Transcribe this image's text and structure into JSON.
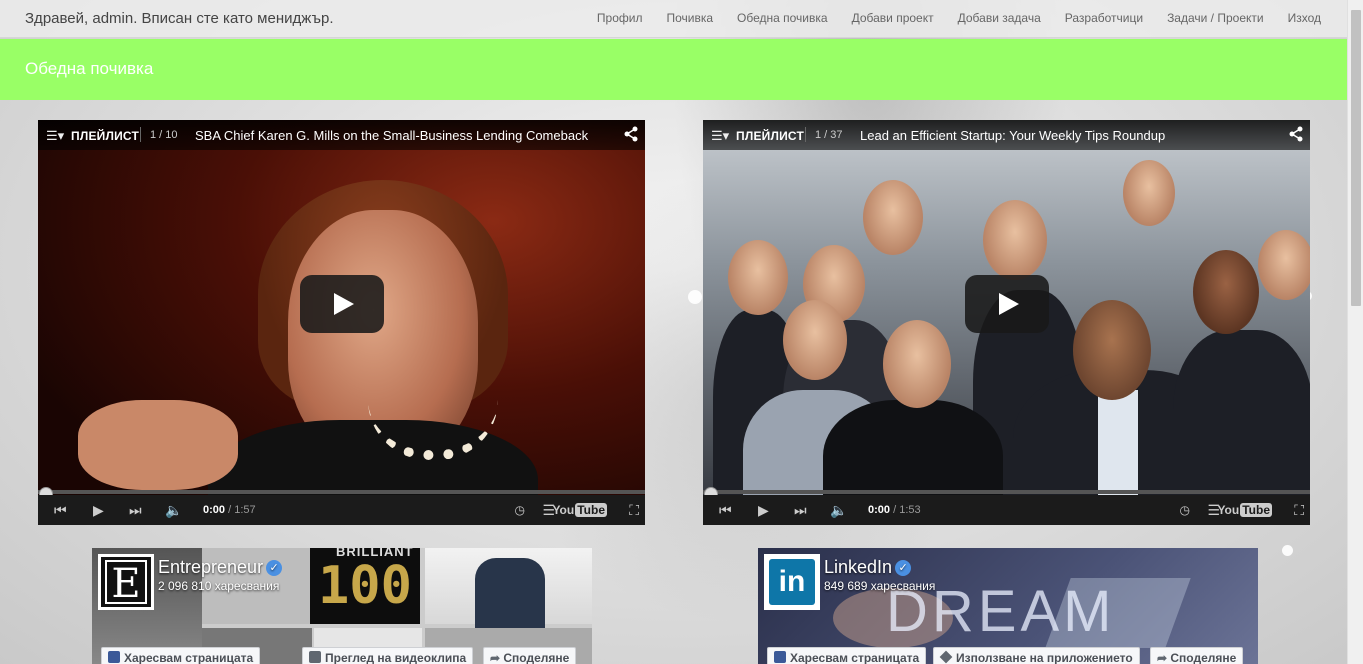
{
  "header": {
    "greeting": "Здравей, admin. Вписан сте като мениджър.",
    "nav": [
      "Профил",
      "Почивка",
      "Обедна почивка",
      "Добави проект",
      "Добави задача",
      "Разработчици",
      "Задачи / Проекти",
      "Изход"
    ]
  },
  "banner": {
    "title": "Обедна почивка"
  },
  "players": [
    {
      "playlist_label": "ПЛЕЙЛИСТ",
      "count": "1 / 10",
      "title": "SBA Chief Karen G. Mills on the Small-Business Lending Comeback",
      "time_current": "0:00",
      "time_total": "/ 1:57",
      "progress": 0
    },
    {
      "playlist_label": "ПЛЕЙЛИСТ",
      "count": "1 / 37",
      "title": "Lead an Efficient Startup: Your Weekly Tips Roundup",
      "time_current": "0:00",
      "time_total": "/ 1:53",
      "progress": 0
    }
  ],
  "player_logo": {
    "you": "You",
    "tube": "Tube"
  },
  "fb_pages": [
    {
      "name": "Entrepreneur",
      "likes": "2 096 810 харесвания",
      "logo_text": "E",
      "cover_text": "BRILLIANT",
      "cover_number": "100",
      "buttons": [
        "Харесвам страницата",
        "Преглед на видеоклипа",
        "Споделяне"
      ]
    },
    {
      "name": "LinkedIn",
      "likes": "849 689 харесвания",
      "logo_text": "in",
      "cover_text": "DREAM",
      "buttons": [
        "Харесвам страницата",
        "Използване на приложението",
        "Споделяне"
      ]
    }
  ],
  "colors": {
    "banner": "#99ff66",
    "verified": "#4a90e2",
    "linkedin": "#0e76a8",
    "facebook": "#3b5998"
  }
}
